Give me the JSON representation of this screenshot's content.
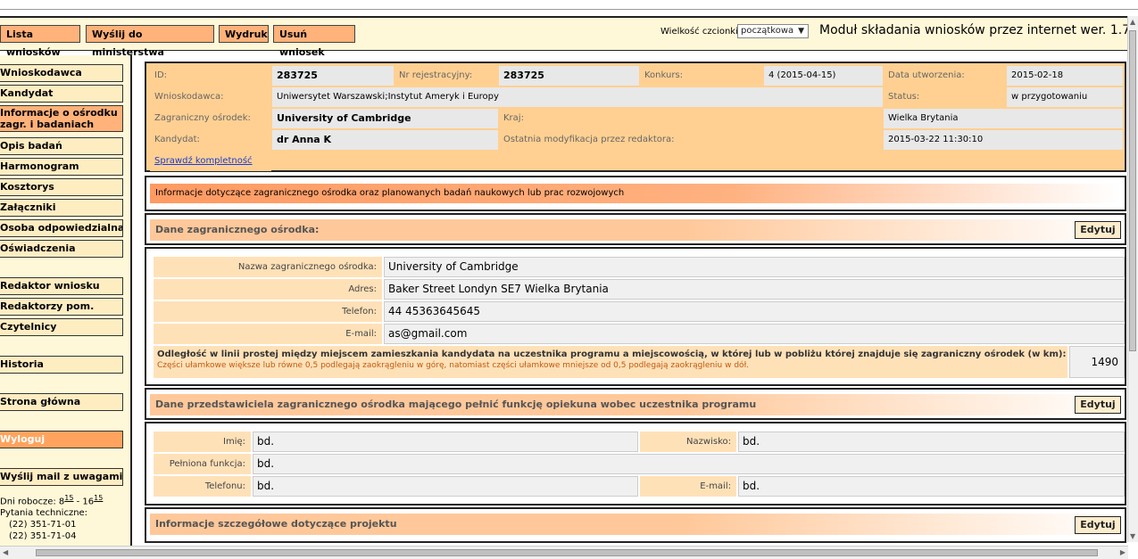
{
  "toolbar": {
    "buttons": [
      "Lista wniosków",
      "Wyślij do ministerstwa",
      "Wydruk",
      "Usuń wniosek"
    ],
    "font_size_label": "Wielkość czcionki:",
    "font_size_value": "początkowa",
    "module_title": "Moduł składania wniosków przez internet wer. 1.7"
  },
  "sidebar": {
    "items": [
      "Wnioskodawca",
      "Kandydat",
      "Informacje o ośrodku zagr. i badaniach",
      "Opis badań",
      "Harmonogram",
      "Kosztorys",
      "Załączniki",
      "Osoba odpowiedzialna",
      "Oświadczenia",
      "Redaktor wniosku",
      "Redaktorzy pom.",
      "Czytelnicy",
      "Historia",
      "Strona główna",
      "Wyloguj",
      "Wyślij mail z uwagami"
    ],
    "hours_label": "Dni robocze: 8",
    "hours_from_sup": "15",
    "hours_sep": " - 16",
    "hours_to_sup": "15",
    "tech_label": "Pytania techniczne:",
    "phone1": "(22) 351-71-01",
    "phone2": "(22) 351-71-04"
  },
  "summary": {
    "id_label": "ID:",
    "id_value": "283725",
    "reg_label": "Nr rejestracyjny:",
    "reg_value": "283725",
    "contest_label": "Konkurs:",
    "contest_value": "4 (2015-04-15)",
    "created_label": "Data utworzenia:",
    "created_value": "2015-02-18",
    "applicant_label": "Wnioskodawca:",
    "applicant_value": "Uniwersytet Warszawski;Instytut Ameryk i Europy",
    "status_label": "Status:",
    "status_value": "w przygotowaniu",
    "center_label": "Zagraniczny ośrodek:",
    "center_value": "University of Cambridge",
    "country_label": "Kraj:",
    "country_value": "Wielka Brytania",
    "candidate_label": "Kandydat:",
    "candidate_value": "dr Anna K",
    "modified_label": "Ostatnia modyfikacja przez redaktora:",
    "modified_value": "2015-03-22 11:30:10",
    "check_link": "Sprawdź kompletność"
  },
  "info_banner": "Informacje dotyczące zagranicznego ośrodka oraz planowanych badań naukowych lub prac rozwojowych",
  "center_section": {
    "title": "Dane zagranicznego ośrodka:",
    "edit": "Edytuj",
    "name_label": "Nazwa zagranicznego ośrodka:",
    "name_value": "University of Cambridge",
    "address_label": "Adres:",
    "address_value": "Baker Street Londyn SE7 Wielka Brytania",
    "phone_label": "Telefon:",
    "phone_value": "44 45363645645",
    "email_label": "E-mail:",
    "email_value": "as@gmail.com",
    "distance_label": "Odległość w linii prostej między miejscem zamieszkania kandydata na uczestnika programu a miejscowością, w której lub w pobliżu której znajduje się zagraniczny ośrodek (w km):",
    "distance_note": "Części ułamkowe większe lub równe 0,5 podlegają zaokrągleniu w górę, natomiast części ułamkowe mniejsze od 0,5 podlegają zaokrągleniu w dół.",
    "distance_value": "1490"
  },
  "rep_section": {
    "title": "Dane przedstawiciela zagranicznego ośrodka mającego pełnić funkcję opiekuna wobec uczestnika programu",
    "edit": "Edytuj",
    "first_label": "Imię:",
    "first_value": "bd.",
    "last_label": "Nazwisko:",
    "last_value": "bd.",
    "function_label": "Pełniona funkcja:",
    "function_value": "bd.",
    "phone_label": "Telefonu:",
    "phone_value": "bd.",
    "email_label": "E-mail:",
    "email_value": "bd."
  },
  "project_section": {
    "title": "Informacje szczegółowe dotyczące projektu",
    "edit": "Edytuj"
  }
}
